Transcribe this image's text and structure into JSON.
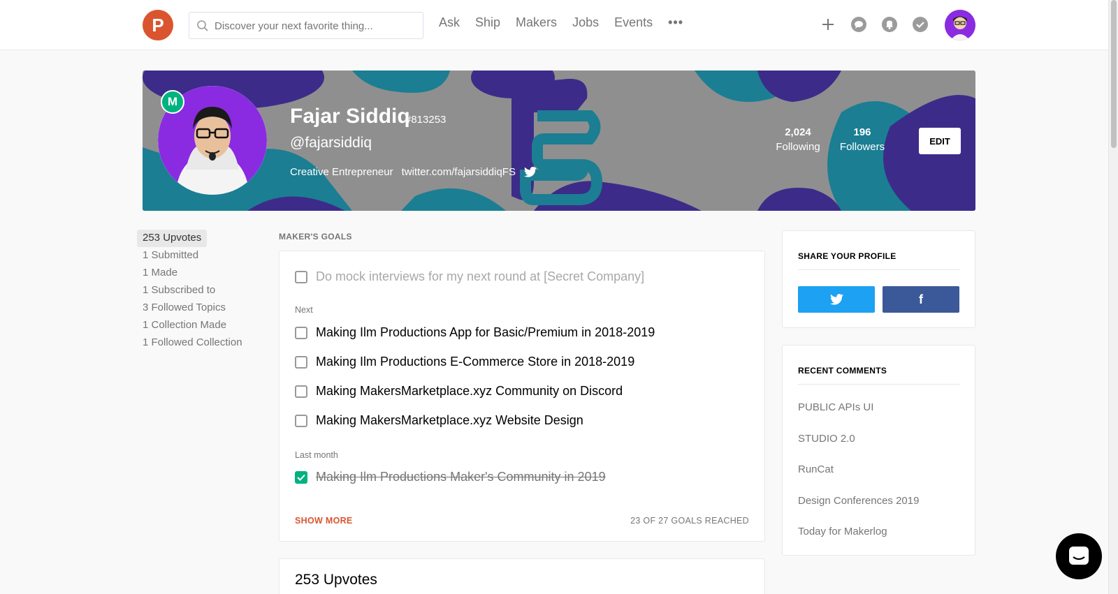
{
  "header": {
    "logo_letter": "P",
    "search_placeholder": "Discover your next favorite thing...",
    "nav": [
      "Ask",
      "Ship",
      "Makers",
      "Jobs",
      "Events",
      "•••"
    ],
    "icons": [
      "plus-icon",
      "chat-icon",
      "bell-icon",
      "check-circle-icon"
    ]
  },
  "profile": {
    "badge": "M",
    "name": "Fajar Siddiq",
    "id": "#813253",
    "handle": "@fajarsiddiq",
    "headline": "Creative Entrepreneur",
    "twitter": "twitter.com/fajarsiddiqFS",
    "following_count": "2,024",
    "following_label": "Following",
    "followers_count": "196",
    "followers_label": "Followers",
    "edit_label": "EDIT"
  },
  "left_nav": [
    "253 Upvotes",
    "1 Submitted",
    "1 Made",
    "1 Subscribed to",
    "3 Followed Topics",
    "1 Collection Made",
    "1 Followed Collection"
  ],
  "goals": {
    "title": "MAKER'S GOALS",
    "current": "Do mock interviews for my next round at [Secret Company]",
    "next_label": "Next",
    "next": [
      "Making Ilm Productions App for Basic/Premium in 2018-2019",
      "Making Ilm Productions E-Commerce Store in 2018-2019",
      "Making MakersMarketplace.xyz Community on Discord",
      "Making MakersMarketplace.xyz Website Design"
    ],
    "last_month_label": "Last month",
    "completed": "Making Ilm Productions Maker's Community in 2019",
    "show_more": "SHOW MORE",
    "reached": "23 OF 27 GOALS REACHED"
  },
  "upvotes_heading": "253 Upvotes",
  "share": {
    "title": "SHARE YOUR PROFILE",
    "facebook_glyph": "f",
    "twitter_color": "#1da1f2",
    "facebook_color": "#3b5998"
  },
  "recent": {
    "title": "RECENT COMMENTS",
    "items": [
      "PUBLIC APIs UI",
      "STUDIO 2.0",
      "RunCat",
      "Design Conferences 2019",
      "Today for Makerlog"
    ]
  },
  "colors": {
    "brand": "#da552f",
    "maker_green": "#00b27f"
  }
}
